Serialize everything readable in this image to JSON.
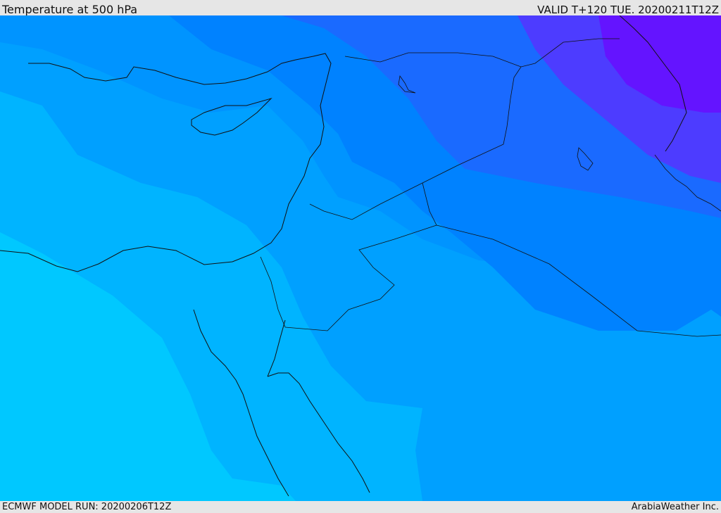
{
  "header": {
    "title": "Temperature at 500 hPa",
    "valid": "VALID T+120 TUE. 20200211T12Z"
  },
  "footer": {
    "model_run": "ECMWF MODEL RUN: 20200206T12Z",
    "credit": "ArabiaWeather Inc."
  },
  "map": {
    "colors": {
      "band_1": "#00c8ff",
      "band_2": "#00b4ff",
      "band_3": "#00a0ff",
      "band_4": "#0094ff",
      "band_5": "#0082ff",
      "band_6": "#1a6aff",
      "band_7": "#4d3cff",
      "band_8": "#6414ff",
      "coastline": "#111111"
    }
  }
}
